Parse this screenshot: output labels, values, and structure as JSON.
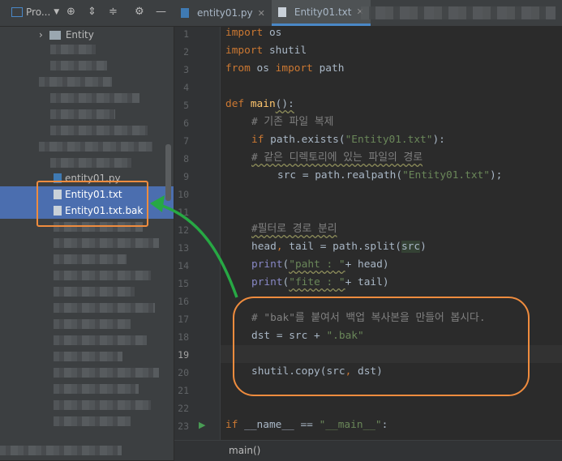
{
  "toolbar": {
    "project_label": "Pro...",
    "icons": [
      "crosshair-icon",
      "expand-all-icon",
      "collapse-all-icon",
      "gear-icon",
      "minimize-icon"
    ]
  },
  "tabs": [
    {
      "label": "entity01.py",
      "active": false
    },
    {
      "label": "Entity01.txt",
      "active": true
    }
  ],
  "tree": {
    "folder": "Entity",
    "items": [
      "entity01.py",
      "Entity01.txt",
      "Entity01.txt.bak"
    ]
  },
  "gutter": {
    "lines": [
      "1",
      "2",
      "3",
      "4",
      "5",
      "6",
      "7",
      "8",
      "9",
      "10",
      "11",
      "12",
      "13",
      "14",
      "15",
      "16",
      "17",
      "18",
      "19",
      "20",
      "21",
      "22",
      "23"
    ]
  },
  "code": {
    "l1_kw": "import",
    "l1_rest": " os",
    "l2_kw": "import",
    "l2_rest": " shutil",
    "l3_kw1": "from",
    "l3_mid": " os ",
    "l3_kw2": "import",
    "l3_rest": " path",
    "l5_kw": "def",
    "l5_fn": "main",
    "l5_rest": "():",
    "l6_cmt": "# 기존 파일 복제",
    "l7_kw": "if",
    "l7_a": " path.exists(",
    "l7_str": "\"Entity01.txt\"",
    "l7_b": "):",
    "l8_cmt": "# 같은 디렉토리에 있는 파일의 경로",
    "l9_a": "src = path.realpath(",
    "l9_str": "\"Entity01.txt\"",
    "l9_b": ");",
    "l12_cmt": "#필터로 경로 분리",
    "l13_a": "head",
    "l13_b": ", ",
    "l13_c": "tail = path.split(",
    "l13_d": "src",
    "l13_e": ")",
    "l14_bi": "print",
    "l14_a": "(",
    "l14_str": "\"paht : \"",
    "l14_b": "+ head)",
    "l15_bi": "print",
    "l15_a": "(",
    "l15_str": "\"fite : \"",
    "l15_b": "+ tail)",
    "l17_cmt": "# \"bak\"를 붙여서 백업 복사본을 만들어 봅시다.",
    "l18_a": "dst = src + ",
    "l18_str": "\".bak\"",
    "l20_a": "shutil.copy(src",
    "l20_b": ", ",
    "l20_c": "dst)",
    "l23_kw": "if",
    "l23_a": " __name__ == ",
    "l23_str": "\"__main__\"",
    "l23_b": ":"
  },
  "status": {
    "breadcrumb": "main()"
  },
  "colors": {
    "callout": "#ef8c3e",
    "arrow": "#27a844",
    "selection": "#4b6eaf"
  }
}
